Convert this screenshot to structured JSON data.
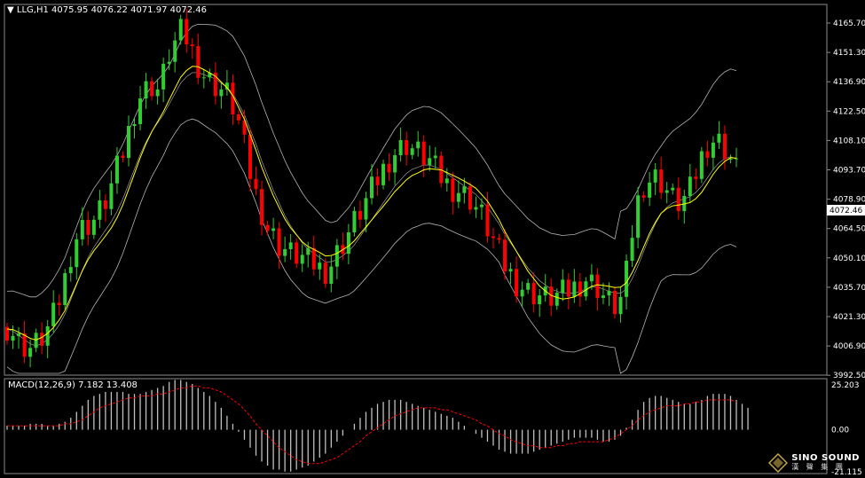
{
  "header": {
    "symbol_label": "LLG,H1",
    "ohlc": "4075.95 4076.22 4071.97 4072.46"
  },
  "macd_header": {
    "label": "MACD(12,26,9) 7.182 13.408"
  },
  "price_axis": {
    "ticks": [
      "4165.70",
      "4151.30",
      "4136.90",
      "4122.50",
      "4108.10",
      "4093.70",
      "4078.90",
      "4064.50",
      "4050.10",
      "4035.70",
      "4021.30",
      "4006.90",
      "3992.50"
    ],
    "current_price_label": "4072.46"
  },
  "macd_axis": {
    "ticks": [
      "25.203",
      "0.00",
      "-21.115"
    ]
  },
  "watermark": {
    "title": "SINO SOUND",
    "subtitle": "漢 聲 集 團"
  },
  "colors": {
    "background": "#000000",
    "bull_candle": "#32cd32",
    "bear_candle": "#ff0000",
    "ma_line": "#ffff00",
    "bollinger": "#b4b4b4",
    "grid_border": "#8c8c8c",
    "macd_hist": "#c0c0c0",
    "macd_signal": "#ff0000",
    "current_price_box": "#ffffff"
  },
  "chart_data": [
    {
      "type": "line",
      "title": "LLG,H1",
      "series": [
        {
          "name": "",
          "values": [
            4015,
            4012,
            4008,
            4006,
            4005,
            4007,
            4010,
            4014,
            4020,
            4028,
            4038,
            4050,
            4058,
            4062,
            4064,
            4066,
            4070,
            4075,
            4082,
            4090,
            4098,
            4108,
            4118,
            4125,
            4128,
            4130,
            4128,
            4135,
            4145,
            4150,
            4155,
            4152,
            4146,
            4140,
            4135,
            4132,
            4130,
            4128,
            4126,
            4120,
            4112,
            4100,
            4088,
            4078,
            4070,
            4062,
            4058,
            4054,
            4052,
            4050,
            4049,
            4048,
            4046,
            4045,
            4043,
            4042,
            4045,
            4050,
            4055,
            4060,
            4065,
            4070,
            4075,
            4080,
            4085,
            4090,
            4095,
            4098,
            4100,
            4102,
            4100,
            4098,
            4096,
            4094,
            4090,
            4086,
            4083,
            4081,
            4080,
            4078,
            4076,
            4072,
            4068,
            4062,
            4056,
            4050,
            4044,
            4040,
            4036,
            4034,
            4032,
            4031,
            4030,
            4029,
            4029,
            4030,
            4031,
            4032,
            4034,
            4036,
            4038,
            4036,
            4034,
            4030,
            4027,
            4025,
            4028,
            4040,
            4060,
            4075,
            4083,
            4085,
            4086,
            4084,
            4080,
            4076,
            4074,
            4076,
            4080,
            4088,
            4096,
            4102,
            4104,
            4103,
            4100,
            4095,
            4090
          ]
        },
        {
          "name": "",
          "values": [
            4014,
            4013,
            4011,
            4009,
            4007,
            4006,
            4007,
            4009,
            4012,
            4016,
            4021,
            4028,
            4035,
            4042,
            4048,
            4053,
            4057,
            4061,
            4065,
            4070,
            4076,
            4083,
            4090,
            4097,
            4103,
            4108,
            4112,
            4116,
            4121,
            4126,
            4131,
            4134,
            4136,
            4136,
            4135,
            4134,
            4133,
            4131,
            4129,
            4126,
            4121,
            4116,
            4109,
            4102,
            4094,
            4087,
            4080,
            4074,
            4068,
            4063,
            4059,
            4055,
            4052,
            4050,
            4048,
            4046,
            4046,
            4047,
            4049,
            4051,
            4054,
            4058,
            4062,
            4066,
            4070,
            4074,
            4078,
            4082,
            4085,
            4088,
            4090,
            4091,
            4092,
            4092,
            4091,
            4090,
            4088,
            4086,
            4084,
            4082,
            4080,
            4078,
            4075,
            4072,
            4068,
            4064,
            4059,
            4055,
            4051,
            4047,
            4043,
            4040,
            4037,
            4035,
            4033,
            4032,
            4031,
            4031,
            4031,
            4032,
            4033,
            4034,
            4034,
            4033,
            4032,
            4031,
            4031,
            4033,
            4038,
            4044,
            4051,
            4058,
            4064,
            4069,
            4072,
            4074,
            4075,
            4076,
            4077,
            4079,
            4082,
            4086,
            4090,
            4093,
            4095,
            4096,
            4095
          ]
        }
      ],
      "ylim": [
        3992.5,
        4168
      ],
      "xlabel": "",
      "ylabel": "",
      "grid": false
    },
    {
      "type": "bar",
      "title": "MACD(12,26,9) 7.182 13.408",
      "series": [
        {
          "name": "",
          "values": [
            2,
            2,
            2,
            2,
            3,
            3,
            3,
            2,
            2,
            3,
            4,
            6,
            9,
            12,
            15,
            17,
            18,
            19,
            19,
            19,
            19,
            18,
            18,
            18,
            19,
            20,
            21,
            22,
            24,
            25,
            25,
            24,
            23,
            21,
            19,
            17,
            14,
            11,
            7,
            3,
            -1,
            -5,
            -9,
            -13,
            -16,
            -18,
            -20,
            -20,
            -21,
            -21,
            -20,
            -19,
            -18,
            -16,
            -14,
            -12,
            -9,
            -6,
            -3,
            0,
            3,
            6,
            9,
            11,
            13,
            14,
            15,
            15,
            15,
            14,
            13,
            12,
            11,
            10,
            9,
            8,
            7,
            6,
            4,
            2,
            0,
            -2,
            -4,
            -6,
            -8,
            -10,
            -11,
            -12,
            -12,
            -12,
            -12,
            -11,
            -10,
            -9,
            -8,
            -7,
            -6,
            -5,
            -4,
            -4,
            -4,
            -4,
            -5,
            -6,
            -6,
            -5,
            -3,
            1,
            5,
            10,
            14,
            16,
            17,
            17,
            16,
            15,
            14,
            13,
            13,
            14,
            15,
            17,
            18,
            18,
            18,
            17,
            15,
            13,
            11
          ]
        },
        {
          "name": "",
          "values": [
            2,
            2,
            2,
            2,
            2,
            2,
            2,
            2,
            2,
            2,
            3,
            3,
            4,
            5,
            7,
            9,
            11,
            12,
            13,
            14,
            15,
            16,
            16,
            17,
            17,
            17,
            18,
            18,
            19,
            20,
            21,
            21,
            22,
            22,
            21,
            21,
            20,
            19,
            17,
            15,
            13,
            10,
            7,
            3,
            0,
            -3,
            -6,
            -9,
            -11,
            -13,
            -15,
            -16,
            -17,
            -17,
            -17,
            -16,
            -15,
            -14,
            -12,
            -10,
            -8,
            -6,
            -3,
            -1,
            1,
            3,
            5,
            7,
            8,
            9,
            10,
            11,
            11,
            11,
            11,
            10,
            10,
            9,
            8,
            7,
            6,
            5,
            3,
            2,
            0,
            -2,
            -3,
            -5,
            -6,
            -7,
            -8,
            -8,
            -9,
            -9,
            -9,
            -8,
            -8,
            -7,
            -7,
            -6,
            -6,
            -6,
            -6,
            -6,
            -5,
            -4,
            -2,
            0,
            2,
            5,
            7,
            9,
            10,
            11,
            12,
            12,
            12,
            13,
            13,
            14,
            14,
            15,
            15,
            15,
            15,
            15,
            14
          ]
        }
      ],
      "ylim": [
        -21.115,
        25.203
      ]
    }
  ]
}
